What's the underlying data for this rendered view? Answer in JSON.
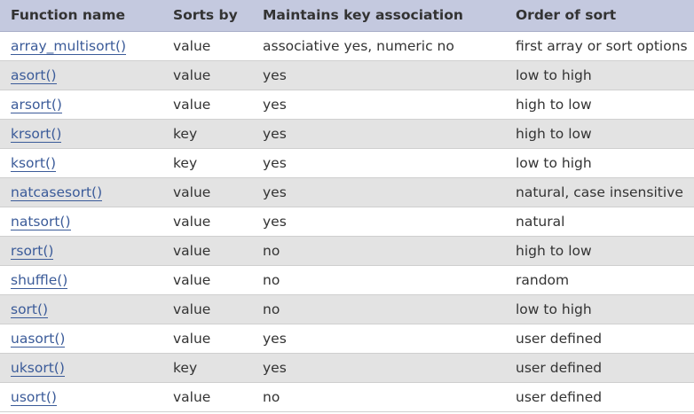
{
  "table": {
    "headers": [
      "Function name",
      "Sorts by",
      "Maintains key association",
      "Order of sort"
    ],
    "rows": [
      [
        "array_multisort()",
        "value",
        "associative yes, numeric no",
        "first array or sort options"
      ],
      [
        "asort()",
        "value",
        "yes",
        "low to high"
      ],
      [
        "arsort()",
        "value",
        "yes",
        "high to low"
      ],
      [
        "krsort()",
        "key",
        "yes",
        "high to low"
      ],
      [
        "ksort()",
        "key",
        "yes",
        "low to high"
      ],
      [
        "natcasesort()",
        "value",
        "yes",
        "natural, case insensitive"
      ],
      [
        "natsort()",
        "value",
        "yes",
        "natural"
      ],
      [
        "rsort()",
        "value",
        "no",
        "high to low"
      ],
      [
        "shuffle()",
        "value",
        "no",
        "random"
      ],
      [
        "sort()",
        "value",
        "no",
        "low to high"
      ],
      [
        "uasort()",
        "value",
        "yes",
        "user defined"
      ],
      [
        "uksort()",
        "key",
        "yes",
        "user defined"
      ],
      [
        "usort()",
        "value",
        "no",
        "user defined"
      ]
    ]
  }
}
